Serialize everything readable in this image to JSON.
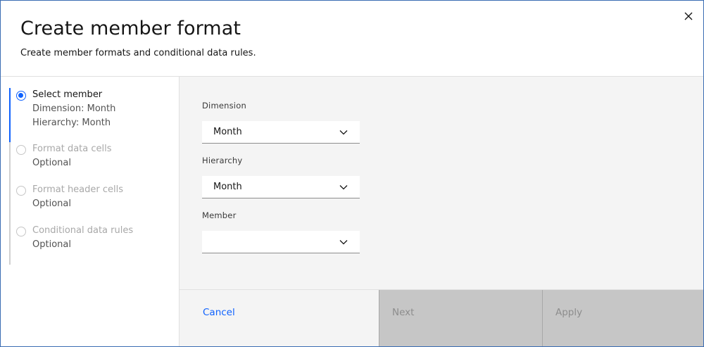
{
  "modal": {
    "title": "Create member format",
    "subtitle": "Create member formats and conditional data rules."
  },
  "icons": {
    "close": "close-icon",
    "chevron": "chevron-down-icon",
    "step": "radio-step-icon"
  },
  "steps": [
    {
      "label": "Select member",
      "sub": [
        "Dimension: Month",
        "Hierarchy: Month"
      ],
      "active": true
    },
    {
      "label": "Format data cells",
      "sub": [
        "Optional"
      ],
      "active": false
    },
    {
      "label": "Format header cells",
      "sub": [
        "Optional"
      ],
      "active": false
    },
    {
      "label": "Conditional data rules",
      "sub": [
        "Optional"
      ],
      "active": false
    }
  ],
  "form": {
    "dimension": {
      "label": "Dimension",
      "value": "Month"
    },
    "hierarchy": {
      "label": "Hierarchy",
      "value": "Month"
    },
    "member": {
      "label": "Member",
      "value": ""
    }
  },
  "footer": {
    "cancel": "Cancel",
    "next": "Next",
    "apply": "Apply"
  },
  "colors": {
    "accent": "#0f62fe",
    "disabled_bg": "#c6c6c6",
    "panel_bg": "#f4f4f4"
  }
}
